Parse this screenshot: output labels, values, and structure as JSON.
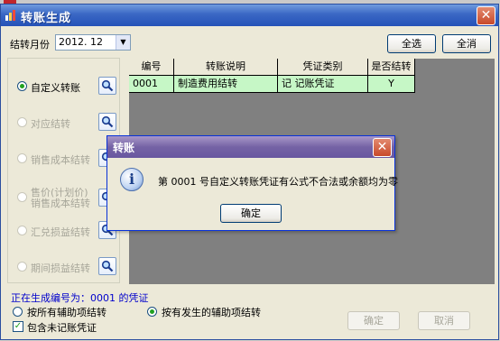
{
  "main_window": {
    "title": "转账生成",
    "month_label": "结转月份",
    "month_value": "2012. 12",
    "select_all_label": "全选",
    "clear_all_label": "全消"
  },
  "options": [
    {
      "label": "自定义转账",
      "enabled": true,
      "selected": true
    },
    {
      "label": "对应结转",
      "enabled": false,
      "selected": false
    },
    {
      "label": "销售成本结转",
      "enabled": false,
      "selected": false
    },
    {
      "label": "售价（计划价）\n销售成本结转",
      "line1": "售价(计划价)",
      "line2": "销售成本结转",
      "enabled": false,
      "selected": false
    },
    {
      "label": "汇兑损益结转",
      "enabled": false,
      "selected": false
    },
    {
      "label": "期间损益结转",
      "enabled": false,
      "selected": false
    }
  ],
  "grid": {
    "columns": [
      "编号",
      "转账说明",
      "凭证类别",
      "是否结转"
    ],
    "rows": [
      [
        "0001",
        "制造费用结转",
        "记 记账凭证",
        "Y"
      ]
    ]
  },
  "status_text": "正在生成编号为：0001 的凭证",
  "aux_options": {
    "by_all_label": "按所有辅助项结转",
    "by_occurred_label": "按有发生的辅助项结转",
    "selected": "by_occurred",
    "include_unposted_label": "包含未记账凭证",
    "include_unposted_checked": true
  },
  "buttons": {
    "ok_label": "确定",
    "cancel_label": "取消"
  },
  "dialog": {
    "title": "转账",
    "message": "第 0001 号自定义转账凭证有公式不合法或余额均为零",
    "ok_label": "确定"
  },
  "colors": {
    "titlebar_main": "#2552b8",
    "titlebar_dialog": "#7563a5",
    "row_highlight": "#c6f7c6",
    "status_text": "#0000cc"
  }
}
